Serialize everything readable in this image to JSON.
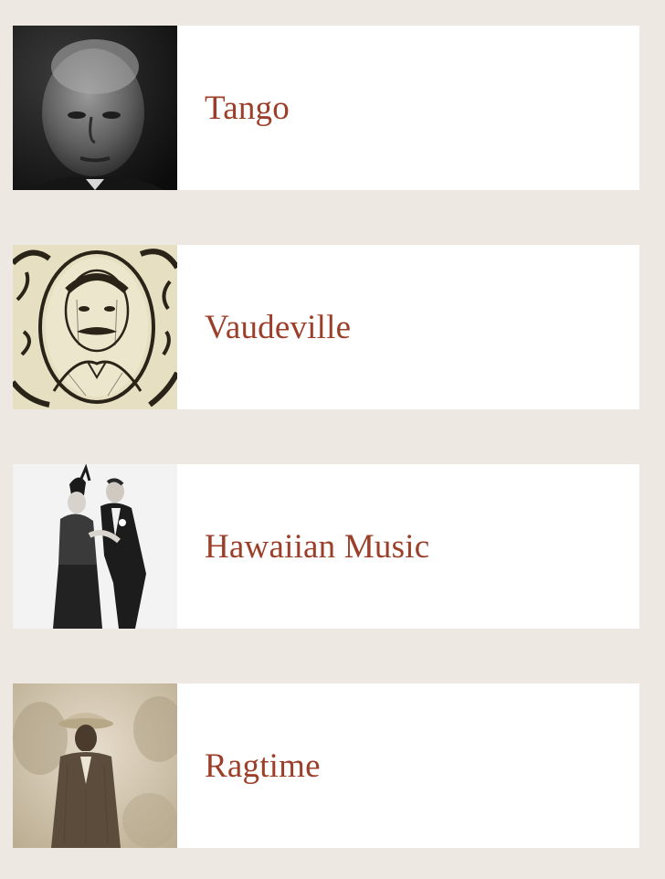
{
  "topics": [
    {
      "label": "Tango",
      "image": "portrait-bald-man-photo"
    },
    {
      "label": "Vaudeville",
      "image": "engraved-portrait-mustache-man"
    },
    {
      "label": "Hawaiian Music",
      "image": "dancing-couple-photo"
    },
    {
      "label": "Ragtime",
      "image": "man-in-hat-sepia-photo"
    }
  ],
  "colors": {
    "background": "#ede9e2",
    "card": "#ffffff",
    "link": "#9c3f2a"
  }
}
